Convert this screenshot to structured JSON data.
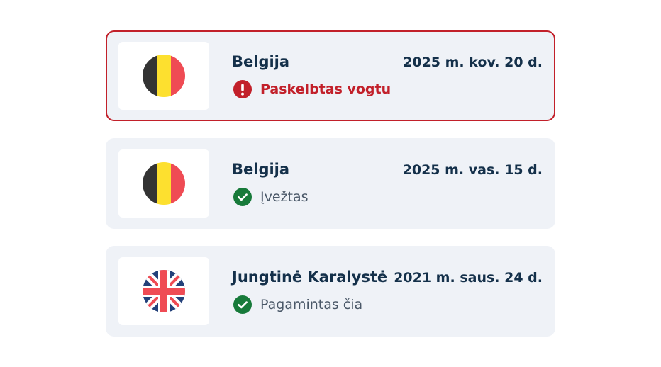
{
  "colors": {
    "card_background": "#eff2f7",
    "alert_border": "#c2202a",
    "alert_text": "#c2202a",
    "success_green": "#177a3a",
    "heading_text": "#14304a",
    "muted_text": "#4a5868"
  },
  "records": [
    {
      "country": "Belgija",
      "flag_icon": "belgium-flag-icon",
      "date": "2025 m. kov. 20 d.",
      "status_icon": "exclamation-circle-icon",
      "status_text": "Paskelbtas vogtu",
      "alert": true
    },
    {
      "country": "Belgija",
      "flag_icon": "belgium-flag-icon",
      "date": "2025 m. vas. 15 d.",
      "status_icon": "check-circle-icon",
      "status_text": "Įvežtas",
      "alert": false
    },
    {
      "country": "Jungtinė Karalystė",
      "flag_icon": "united-kingdom-flag-icon",
      "date": "2021 m. saus. 24 d.",
      "status_icon": "check-circle-icon",
      "status_text": "Pagamintas čia",
      "alert": false
    }
  ]
}
